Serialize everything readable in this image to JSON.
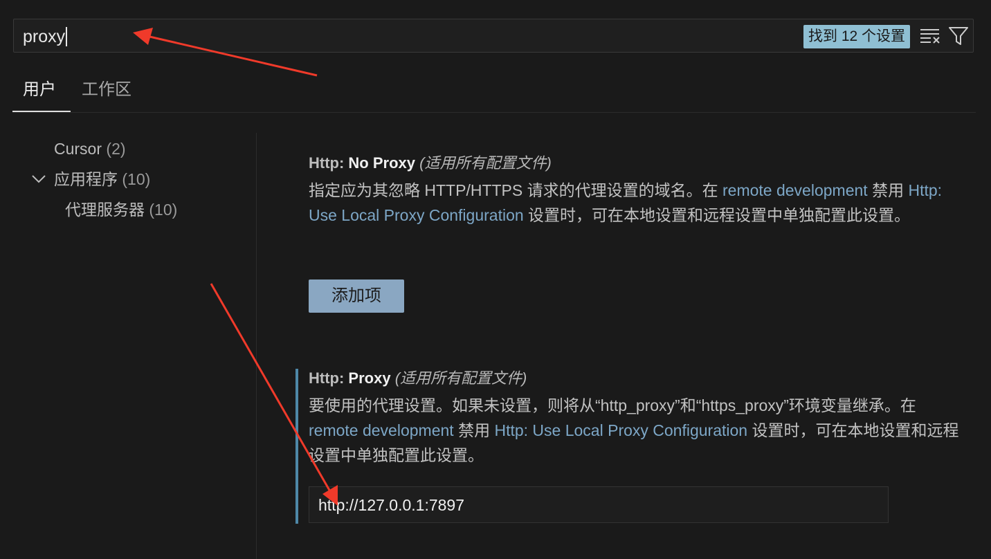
{
  "search": {
    "value": "proxy",
    "result_count": "找到 12 个设置"
  },
  "tabs": [
    {
      "label": "用户",
      "active": true
    },
    {
      "label": "工作区",
      "active": false
    }
  ],
  "toc": [
    {
      "label": "Cursor",
      "count": "(2)"
    },
    {
      "label": "应用程序",
      "count": "(10)",
      "expanded": true
    },
    {
      "label": "代理服务器",
      "count": "(10)"
    }
  ],
  "settings": {
    "no_proxy": {
      "category": "Http: ",
      "name": "No Proxy",
      "scope": "(适用所有配置文件)",
      "desc_1": "指定应为其忽略 HTTP/HTTPS 请求的代理设置的域名。在 ",
      "link_1": "remote development",
      "desc_2": " 禁用 ",
      "link_2": "Http: Use Local Proxy Configuration",
      "desc_3": " 设置时，可在本地设置和远程设置中单独配置此设置。",
      "button_label": "添加项"
    },
    "proxy": {
      "category": "Http: ",
      "name": "Proxy",
      "scope": "(适用所有配置文件)",
      "desc_1": "要使用的代理设置。如果未设置，则将从“http_proxy”和“https_proxy”环境变量继承。在 ",
      "link_1": "remote development",
      "desc_2": " 禁用 ",
      "link_2": "Http: Use Local Proxy Configuration",
      "desc_3": " 设置时，可在本地设置和远程设置中单独配置此设置。",
      "value": "http://127.0.0.1:7897"
    }
  },
  "colors": {
    "accent_badge": "#8fbfd3",
    "link": "#7da7c7",
    "annotation_arrow": "#f03a2a",
    "focus_bar": "#4e88a8"
  }
}
